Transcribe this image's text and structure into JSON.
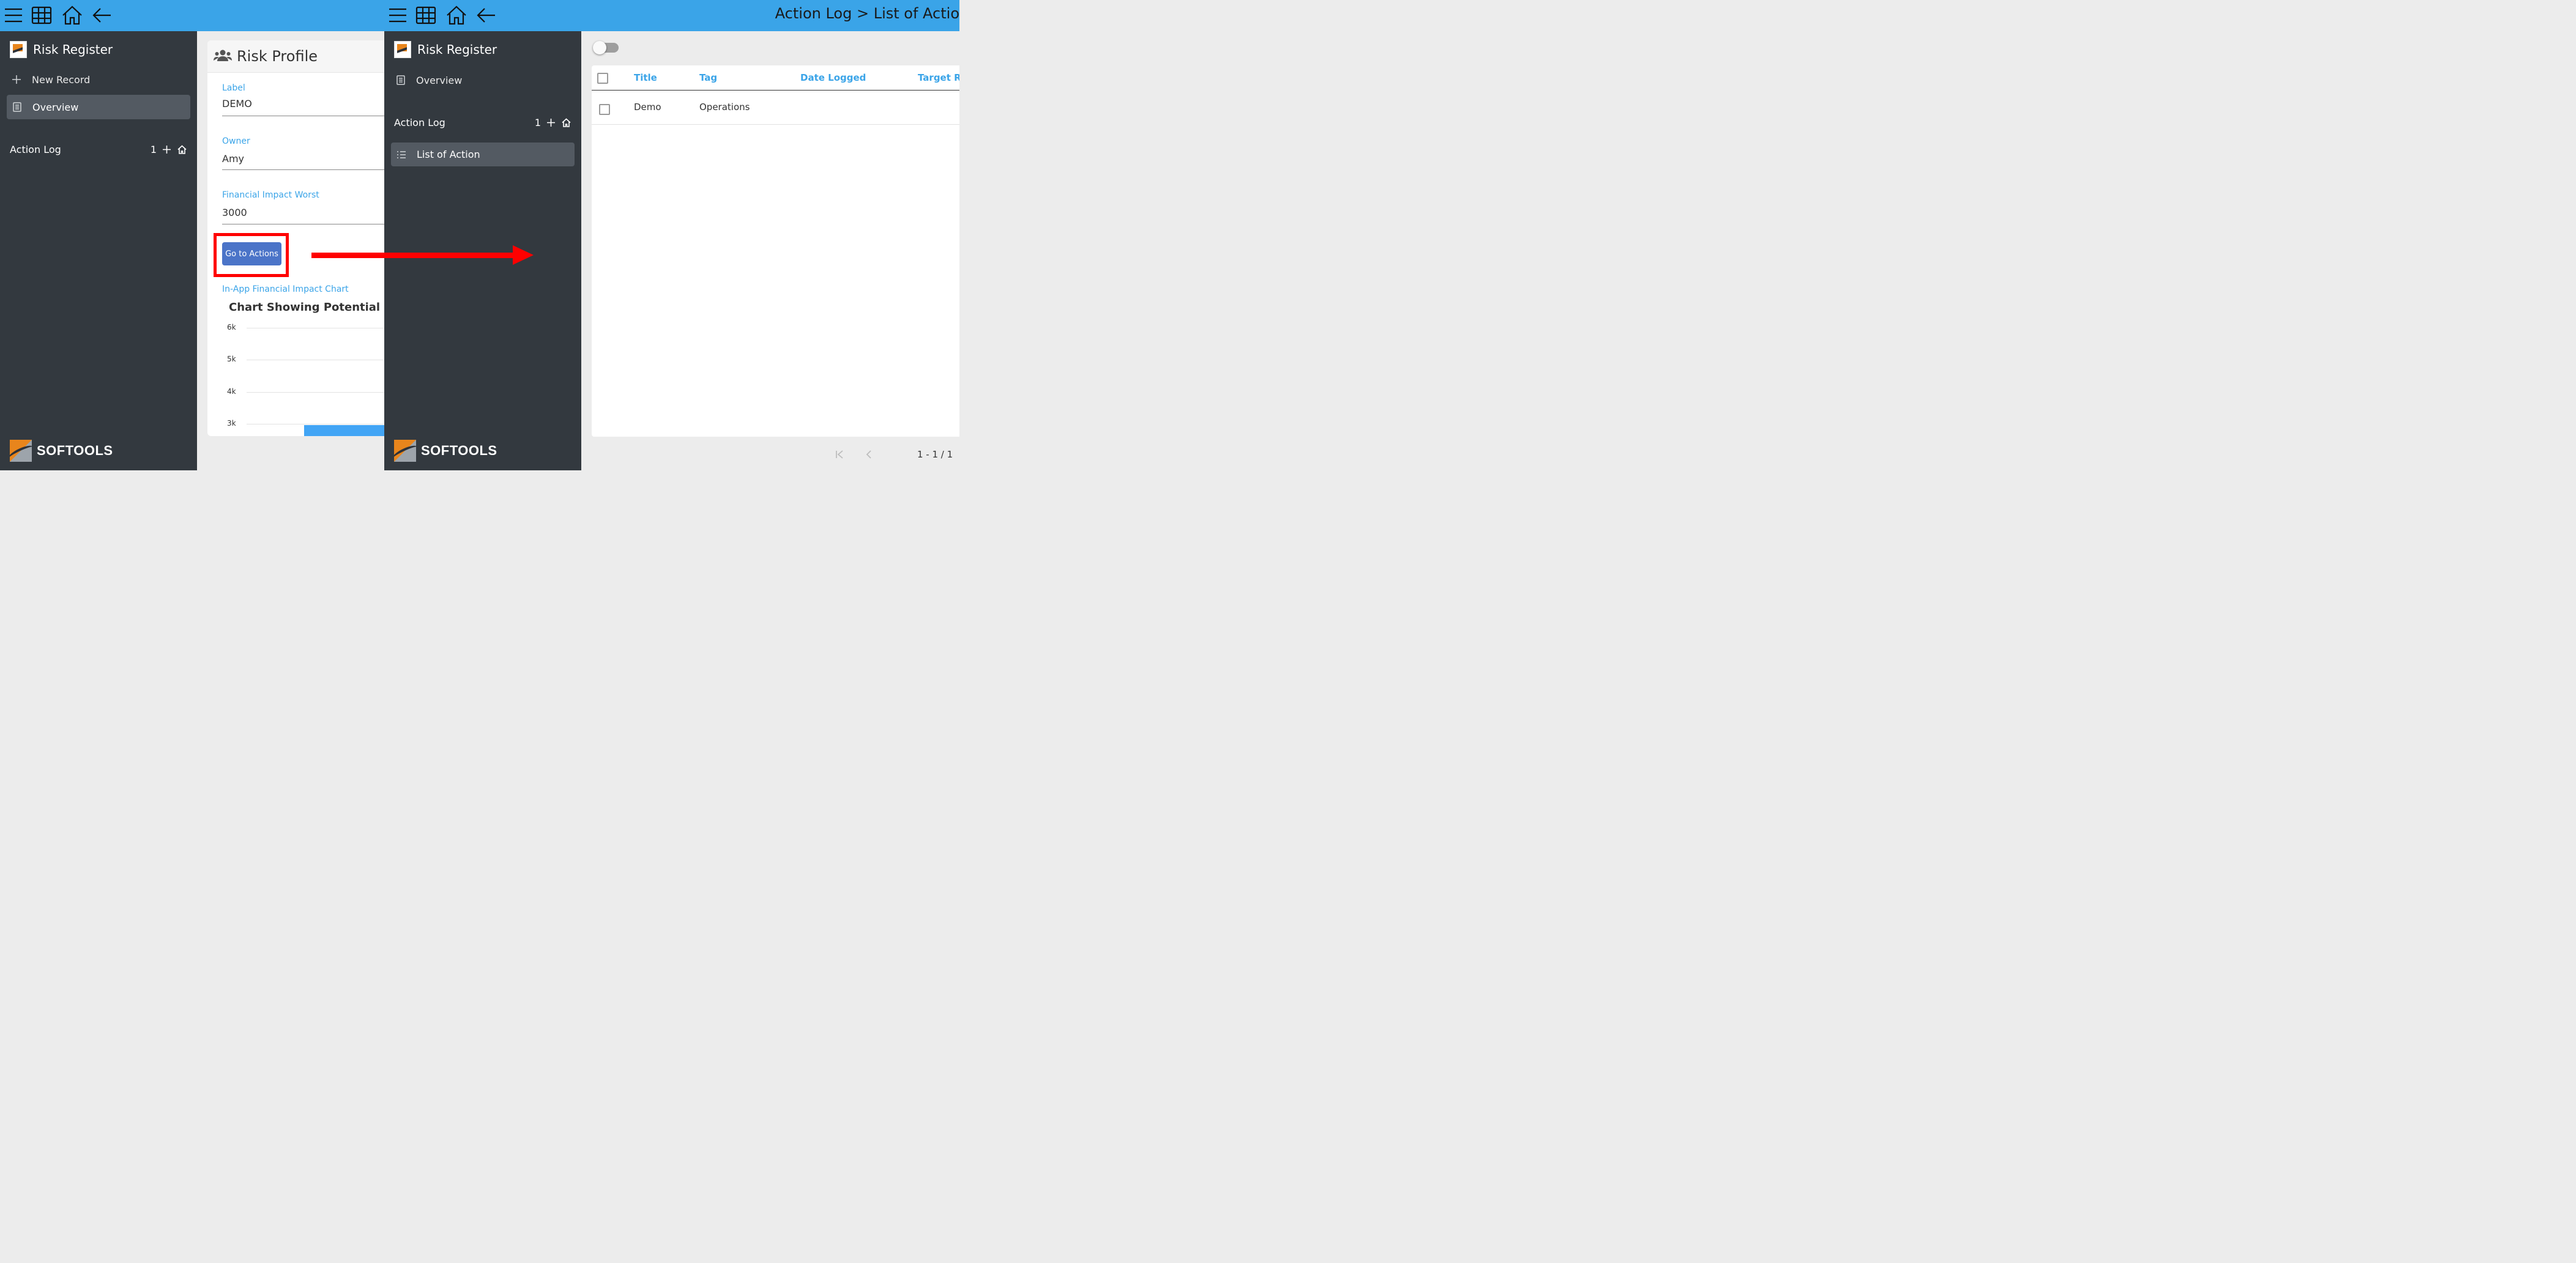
{
  "left_pane": {
    "sidebar": {
      "app_title": "Risk Register",
      "items": [
        {
          "label": "New Record",
          "icon": "plus-icon"
        },
        {
          "label": "Overview",
          "icon": "report-icon",
          "active": true
        }
      ],
      "group": {
        "label": "Action Log",
        "count": "1"
      },
      "brand": "SOFTOOLS"
    },
    "card": {
      "title": "Risk Profile",
      "fields": [
        {
          "label": "Label",
          "value": "DEMO"
        },
        {
          "label": "Owner",
          "value": "Amy"
        },
        {
          "label": "Financial Impact Worst",
          "value": "3000"
        }
      ],
      "action_button": "Go to Actions",
      "chart_section_label": "In-App Financial Impact Chart",
      "chart_title": "Chart Showing Potential Fin"
    }
  },
  "chart_data": {
    "type": "bar",
    "title": "Chart Showing Potential Fin",
    "y_ticks": [
      "6k",
      "5k",
      "4k",
      "3k"
    ],
    "ylim": [
      3000,
      6000
    ],
    "series": [
      {
        "values": [
          3000
        ]
      }
    ],
    "grid": true
  },
  "right_pane": {
    "header_title": "Action Log > List of Actio",
    "sidebar": {
      "app_title": "Risk Register",
      "items": [
        {
          "label": "Overview",
          "icon": "report-icon"
        }
      ],
      "group": {
        "label": "Action Log",
        "count": "1"
      },
      "sub_items": [
        {
          "label": "List of Action",
          "icon": "list-icon",
          "active": true
        }
      ],
      "brand": "SOFTOOLS"
    },
    "table": {
      "columns": [
        "Title",
        "Tag",
        "Date Logged",
        "Target R"
      ],
      "rows": [
        {
          "title": "Demo",
          "tag": "Operations",
          "date_logged": "",
          "target": ""
        }
      ]
    },
    "pagination": "1 - 1 / 1"
  },
  "colors": {
    "topbar": "#3aa4e8",
    "sidebar": "#33393f",
    "active_item": "#535a62",
    "accent": "#3aa4e8",
    "button": "#4b74c8",
    "highlight": "#ff0000"
  }
}
